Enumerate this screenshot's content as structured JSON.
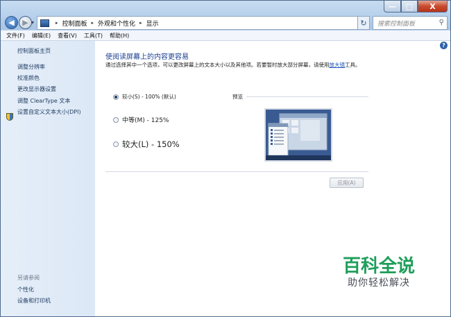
{
  "window": {
    "controls": {
      "minimize": "—",
      "maximize": "□",
      "close": "X"
    }
  },
  "nav": {
    "back_glyph": "◀",
    "forward_glyph": "▶",
    "dropdown_glyph": "▾"
  },
  "address": {
    "crumbs": [
      "控制面板",
      "外观和个性化",
      "显示"
    ],
    "separator": "▸",
    "dropdown_glyph": "▾",
    "refresh_glyph": "↻"
  },
  "search": {
    "placeholder": "搜索控制面板",
    "icon": "search-icon"
  },
  "menu": {
    "items": [
      "文件(F)",
      "编辑(E)",
      "查看(V)",
      "工具(T)",
      "帮助(H)"
    ]
  },
  "sidebar": {
    "links": [
      "控制面板主页",
      "调整分辨率",
      "校准颜色",
      "更改显示器设置",
      "调整 ClearType 文本",
      "设置自定义文本大小(DPI)"
    ],
    "see_also_title": "另请参阅",
    "see_also": [
      "个性化",
      "设备和打印机"
    ]
  },
  "content": {
    "help_glyph": "?",
    "heading": "使阅读屏幕上的内容更容易",
    "description": "通过选择其中一个选项，可以更改屏幕上的文本大小以及其他项。若要暂时放大部分屏幕，请使用",
    "description_link": "放大镜",
    "description_tail": "工具。",
    "options": [
      {
        "label": "较小(S) - 100% (默认)",
        "selected": true
      },
      {
        "label": "中等(M) - 125%",
        "selected": false
      },
      {
        "label": "较大(L) - 150%",
        "selected": false
      }
    ],
    "preview_label": "预览",
    "apply_label": "应用(A)",
    "apply_enabled": false
  },
  "watermark": {
    "title": "百科全说",
    "subtitle": "助你轻松解决",
    "color": "#1e9e5a"
  }
}
